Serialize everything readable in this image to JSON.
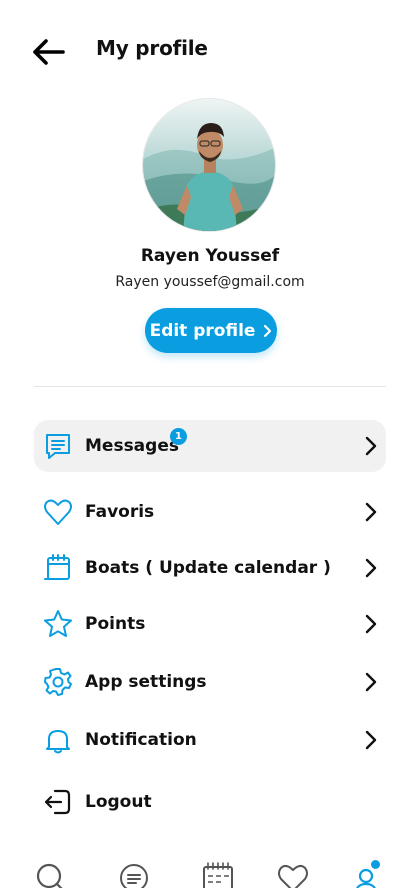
{
  "header": {
    "title": "My profile"
  },
  "profile": {
    "name": "Rayen Youssef",
    "email": "Rayen youssef@gmail.com",
    "edit_label": "Edit profile"
  },
  "menu": {
    "items": [
      {
        "label": "Messages",
        "icon": "message-icon",
        "badge": "1"
      },
      {
        "label": "Favoris",
        "icon": "heart-icon"
      },
      {
        "label": "Boats ( Update calendar )",
        "icon": "calendar-icon"
      },
      {
        "label": "Points",
        "icon": "star-icon"
      },
      {
        "label": "App settings",
        "icon": "gear-icon"
      },
      {
        "label": "Notification",
        "icon": "bell-icon"
      },
      {
        "label": "Logout",
        "icon": "logout-icon"
      }
    ]
  },
  "bottom_nav": {
    "items": [
      "search-icon",
      "message-icon",
      "calendar-icon",
      "heart-icon",
      "profile-icon"
    ],
    "active": "profile-icon"
  },
  "colors": {
    "accent": "#0a9ee0",
    "text": "#111111",
    "active_row": "#f1f1f1"
  }
}
